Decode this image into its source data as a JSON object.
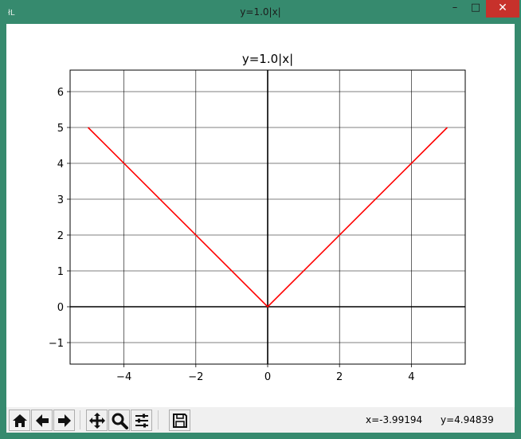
{
  "window": {
    "title": "y=1.0|x|",
    "controls": {
      "minimize": "–",
      "maximize": "□",
      "close": "✕"
    }
  },
  "chart_data": {
    "type": "line",
    "title": "y=1.0|x|",
    "xlabel": "",
    "ylabel": "",
    "xlim": [
      -5.5,
      5.5
    ],
    "ylim": [
      -1.6,
      6.6
    ],
    "xticks": [
      -4,
      -2,
      0,
      2,
      4
    ],
    "yticks": [
      -1,
      0,
      1,
      2,
      3,
      4,
      5,
      6
    ],
    "xtick_labels": [
      "−4",
      "−2",
      "0",
      "2",
      "4"
    ],
    "ytick_labels": [
      "−1",
      "0",
      "1",
      "2",
      "3",
      "4",
      "5",
      "6"
    ],
    "grid": true,
    "axes_lines": {
      "x_zero": true,
      "y_zero": true,
      "color": "#000000"
    },
    "series": [
      {
        "x": [
          -5,
          0,
          5
        ],
        "y": [
          5,
          0,
          5
        ],
        "color": "#ff0000"
      }
    ]
  },
  "toolbar": {
    "buttons": [
      {
        "name": "home-button",
        "icon": "home-icon"
      },
      {
        "name": "back-button",
        "icon": "back-arrow-icon"
      },
      {
        "name": "forward-button",
        "icon": "forward-arrow-icon"
      },
      {
        "name": "pan-button",
        "icon": "pan-icon"
      },
      {
        "name": "zoom-button",
        "icon": "magnifier-icon"
      },
      {
        "name": "subplots-button",
        "icon": "sliders-icon"
      },
      {
        "name": "save-button",
        "icon": "floppy-disk-icon"
      }
    ],
    "coords_x": "x=-3.99194",
    "coords_y": "y=4.94839"
  }
}
